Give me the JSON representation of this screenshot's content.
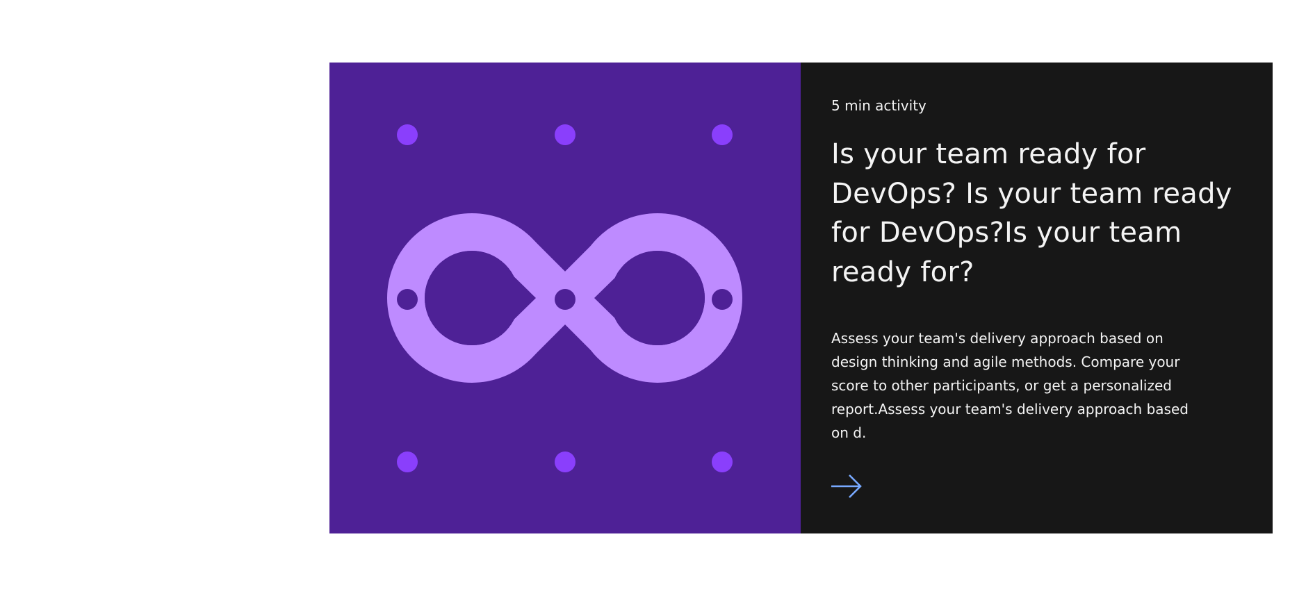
{
  "card": {
    "eyebrow": "5 min activity",
    "headline": "Is your team ready for DevOps? Is your team ready for DevOps?Is your team ready for?",
    "description": "Assess your team's delivery approach based on design thinking and agile methods. Compare your score to other participants, or get a personalized report.Assess your team's delivery approach based on d.",
    "link_icon": "arrow-right-icon",
    "illustration_icon": "infinity-icon"
  },
  "colors": {
    "media_background": "#4e2196",
    "infinity": "#be8bff",
    "dots": "#8a3ffc",
    "content_background": "#171717",
    "text": "#f4f4f4",
    "link": "#78a9ff"
  }
}
